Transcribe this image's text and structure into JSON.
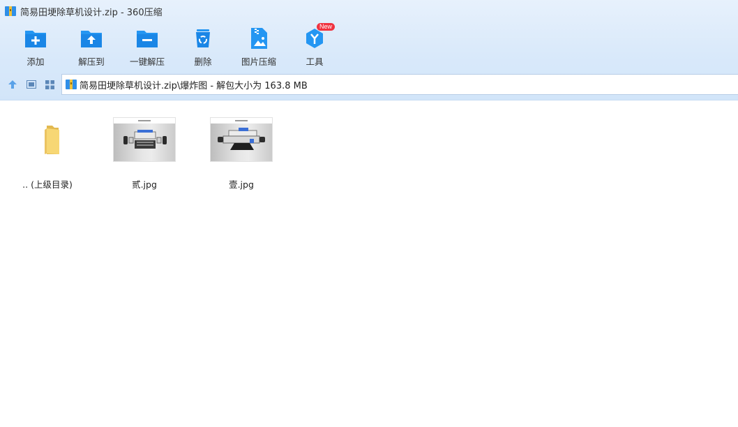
{
  "window": {
    "title": "简易田埂除草机设计.zip - 360压缩"
  },
  "toolbar": {
    "items": [
      {
        "label": "添加",
        "icon": "folder-add-icon"
      },
      {
        "label": "解压到",
        "icon": "folder-extract-icon"
      },
      {
        "label": "一键解压",
        "icon": "folder-one-click-extract-icon"
      },
      {
        "label": "删除",
        "icon": "recycle-bin-icon"
      },
      {
        "label": "图片压缩",
        "icon": "image-compress-icon"
      },
      {
        "label": "工具",
        "icon": "tools-icon",
        "badge": "New"
      }
    ]
  },
  "navbar": {
    "path": "简易田埂除草机设计.zip\\爆炸图 - 解包大小为 163.8 MB"
  },
  "files": [
    {
      "name": ".. (上级目录)",
      "type": "parent-folder"
    },
    {
      "name": "贰.jpg",
      "type": "image"
    },
    {
      "name": "壹.jpg",
      "type": "image"
    }
  ],
  "colors": {
    "accent": "#1a8cf0",
    "icon_blue": "#2496f2",
    "folder_yellow": "#f7d774",
    "badge_red": "#f03340"
  }
}
